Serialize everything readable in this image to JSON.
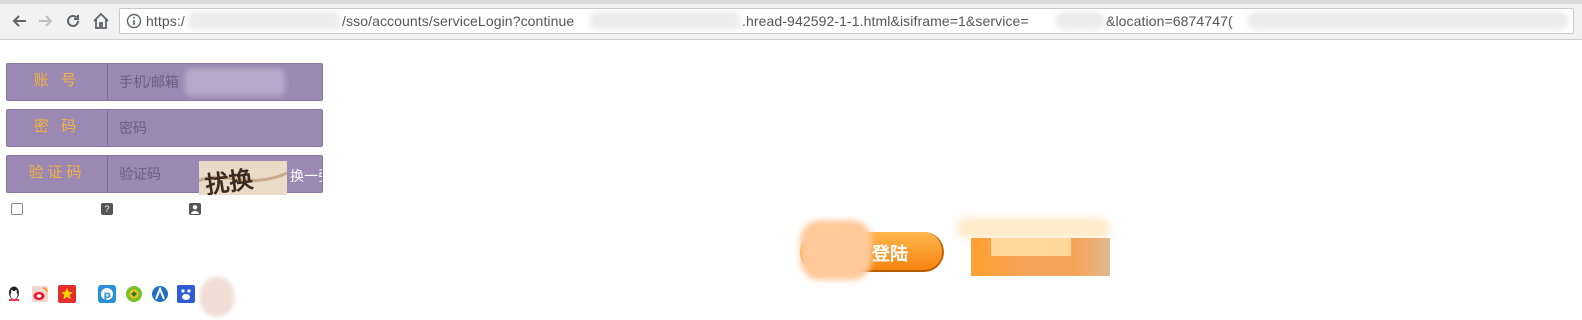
{
  "browser": {
    "url": "https:/[blurred]/sso/accounts/serviceLogin?continue[blurred].hread-942592-1-1.html&isiframe=1&service=[blurred]&location=6874747[blurred]",
    "url_parts": [
      "https:/",
      "/sso/accounts/serviceLogin?continue",
      ".hread-942592-1-1.html&isiframe=1&service=",
      "&location=6874747("
    ]
  },
  "login_form": {
    "account": {
      "label": "账 号",
      "placeholder": "手机/邮箱"
    },
    "password": {
      "label": "密 码",
      "placeholder": "密码"
    },
    "captcha": {
      "label": "验证码",
      "placeholder": "验证码",
      "refresh_label": "换一张",
      "image_text": "扰换"
    }
  },
  "buttons": {
    "login": "登陆"
  },
  "icons": {
    "remember": "checkbox-icon",
    "help": "question-icon",
    "user": "user-icon",
    "social": [
      "qq-icon",
      "weibo-icon",
      "star-icon",
      "p-icon",
      "green-circle-icon",
      "renren-icon",
      "baidu-icon"
    ]
  },
  "colors": {
    "form_bg": "#9b88b3",
    "label": "#f3b33c",
    "login_btn": "#f58410"
  }
}
